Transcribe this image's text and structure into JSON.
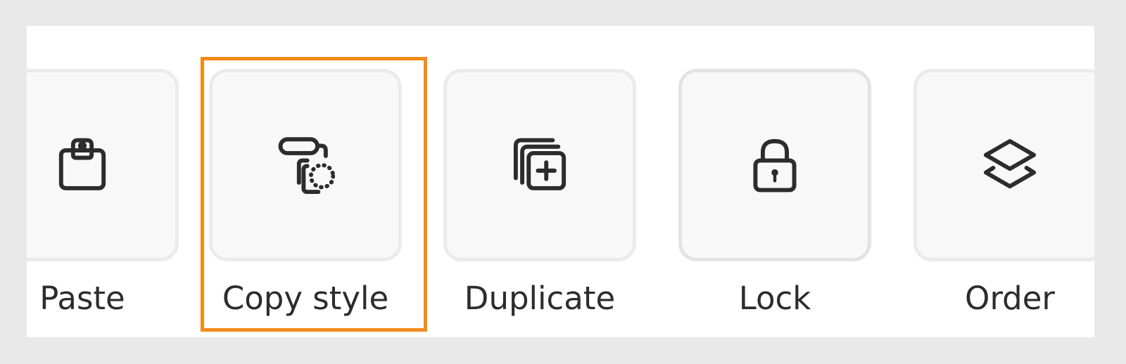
{
  "actions": [
    {
      "label": "Paste",
      "icon": "clipboard-icon"
    },
    {
      "label": "Copy style",
      "icon": "paint-roller-icon",
      "selected": true
    },
    {
      "label": "Duplicate",
      "icon": "duplicate-icon"
    },
    {
      "label": "Lock",
      "icon": "lock-icon"
    },
    {
      "label": "Order",
      "icon": "layers-icon"
    }
  ],
  "colors": {
    "background": "#e9e9e9",
    "panel": "#ffffff",
    "tile_fill": "#f8f8f8",
    "tile_border": "#ebebeb",
    "text": "#2c2c2c",
    "icon": "#2c2c2c",
    "selection": "#f38b1b"
  }
}
